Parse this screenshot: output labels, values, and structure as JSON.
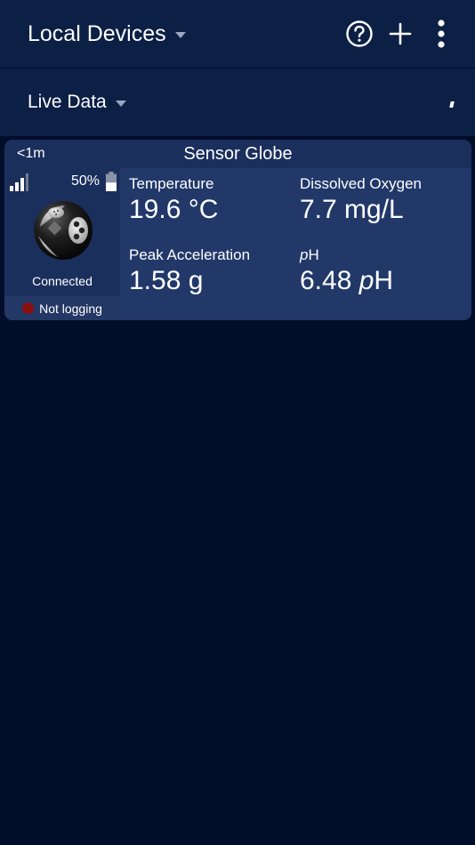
{
  "appbar": {
    "title": "Local Devices",
    "icons": [
      "help-icon",
      "add-icon",
      "more-vertical-icon"
    ]
  },
  "view": {
    "title": "Live Data"
  },
  "device_card": {
    "age": "<1m",
    "name": "Sensor Globe",
    "battery": "50%",
    "battery_level": 0.5,
    "signal_bars": 3,
    "status": "Connected",
    "logging": "Not logging",
    "logging_color": "#8a1010",
    "readings": [
      {
        "label": "Temperature",
        "value": "19.6 °C"
      },
      {
        "label": "Dissolved Oxygen",
        "value": "7.7 mg/L"
      },
      {
        "label": "Peak Acceleration",
        "value": "1.58 g"
      },
      {
        "label_italic": "p",
        "label_rest": "H",
        "value_num": "6.48 ",
        "value_unit_italic": "p",
        "value_unit_rest": "H"
      }
    ]
  },
  "colors": {
    "background": "#020d2a",
    "bar": "#0c1f45",
    "card": "#1b2f5c",
    "readings_panel": "#213869"
  }
}
